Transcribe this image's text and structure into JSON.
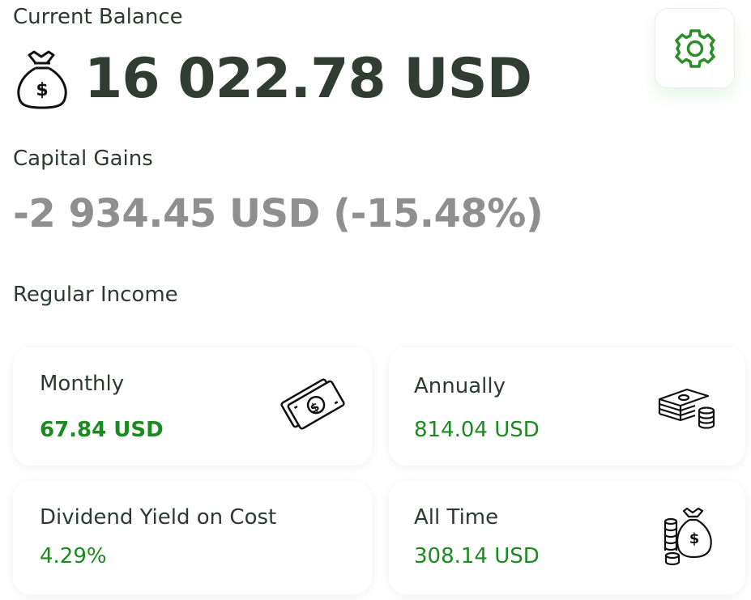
{
  "header": {
    "current_balance_label": "Current Balance",
    "current_balance_value": "16 022.78 USD",
    "capital_gains_label": "Capital Gains",
    "capital_gains_value": "-2 934.45 USD (-15.48%)",
    "regular_income_label": "Regular Income"
  },
  "cards": {
    "monthly": {
      "title": "Monthly",
      "value": "67.84 USD",
      "icon": "banknotes-icon"
    },
    "annually": {
      "title": "Annually",
      "value": "814.04 USD",
      "icon": "cash-stack-icon"
    },
    "yield": {
      "title": "Dividend Yield on Cost",
      "value": "4.29%"
    },
    "all_time": {
      "title": "All Time",
      "value": "308.14 USD",
      "icon": "money-bag-coins-icon"
    }
  },
  "icons": {
    "balance": "money-bag-icon",
    "settings": "gear-icon"
  },
  "colors": {
    "positive": "#1b8a21",
    "neutral_value": "#8f8f91",
    "dark_text": "#313d33",
    "accent": "#2a8f2a"
  }
}
